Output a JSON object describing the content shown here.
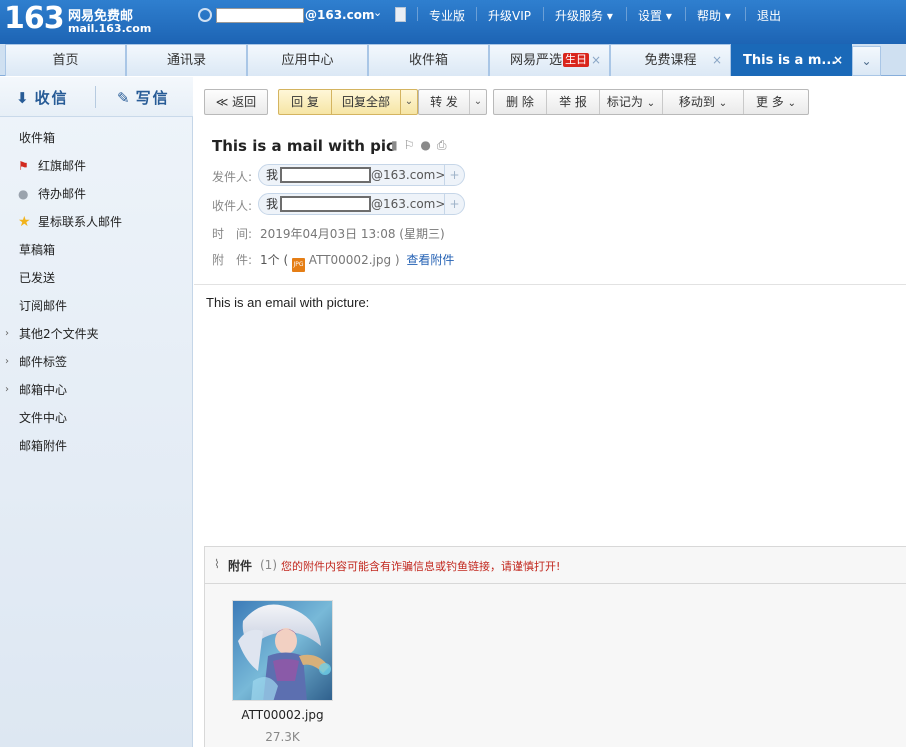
{
  "topbar": {
    "logo_number": "163",
    "logo_cn": "网易免费邮",
    "logo_domain": "mail.163.com",
    "user_domain": "@163.com",
    "nav": [
      "专业版",
      "升级VIP",
      "升级服务 ▾",
      "设置 ▾",
      "帮助 ▾",
      "退出"
    ]
  },
  "tabs": {
    "items": [
      {
        "label": "首页"
      },
      {
        "label": "通讯录"
      },
      {
        "label": "应用中心"
      },
      {
        "label": "收件箱"
      },
      {
        "label": "网易严选",
        "badge": "生日"
      },
      {
        "label": "免费课程"
      },
      {
        "label": "This is a m..."
      }
    ],
    "close_glyph": "×",
    "more_glyph": "⌄"
  },
  "sidebar": {
    "receive_label": "收信",
    "compose_label": "写信",
    "folders": [
      {
        "label": "收件箱"
      },
      {
        "label": "红旗邮件",
        "icon": "flag-icon"
      },
      {
        "label": "待办邮件",
        "icon": "clock-icon"
      },
      {
        "label": "星标联系人邮件",
        "icon": "star-icon"
      },
      {
        "label": "草稿箱"
      },
      {
        "label": "已发送"
      },
      {
        "label": "订阅邮件"
      },
      {
        "label": "其他2个文件夹",
        "expandable": true
      },
      {
        "label": "邮件标签",
        "expandable": true
      },
      {
        "label": "邮箱中心",
        "expandable": true
      },
      {
        "label": "文件中心"
      },
      {
        "label": "邮箱附件"
      }
    ]
  },
  "toolbar": {
    "back": "≪ 返回",
    "reply": "回 复",
    "reply_all": "回复全部",
    "forward": "转 发",
    "delete": "删 除",
    "report": "举 报",
    "mark_as": "标记为",
    "move_to": "移动到",
    "more": "更 多"
  },
  "mail": {
    "subject": "This is a mail with pic",
    "from_label": "发件人:",
    "to_label": "收件人:",
    "me": "我",
    "address_domain": "@163.com>",
    "time_label": "时　间:",
    "time_value": "2019年04月03日 13:08 (星期三)",
    "attach_label": "附　件:",
    "attach_count": "1个 (",
    "attach_file": "ATT00002.jpg )",
    "view_attachments": "查看附件",
    "body": "This is an email with picture:"
  },
  "attachments": {
    "title": "附件",
    "count": "(1)",
    "warning": "您的附件内容可能含有诈骗信息或钓鱼链接，请谨慎打开!",
    "files": [
      {
        "name": "ATT00002.jpg",
        "size": "27.3K"
      }
    ]
  },
  "colors": {
    "brand_blue": "#1d64b4",
    "active_tab": "#1a69b8",
    "warning_red": "#c2281f",
    "link_blue": "#2562b4"
  }
}
